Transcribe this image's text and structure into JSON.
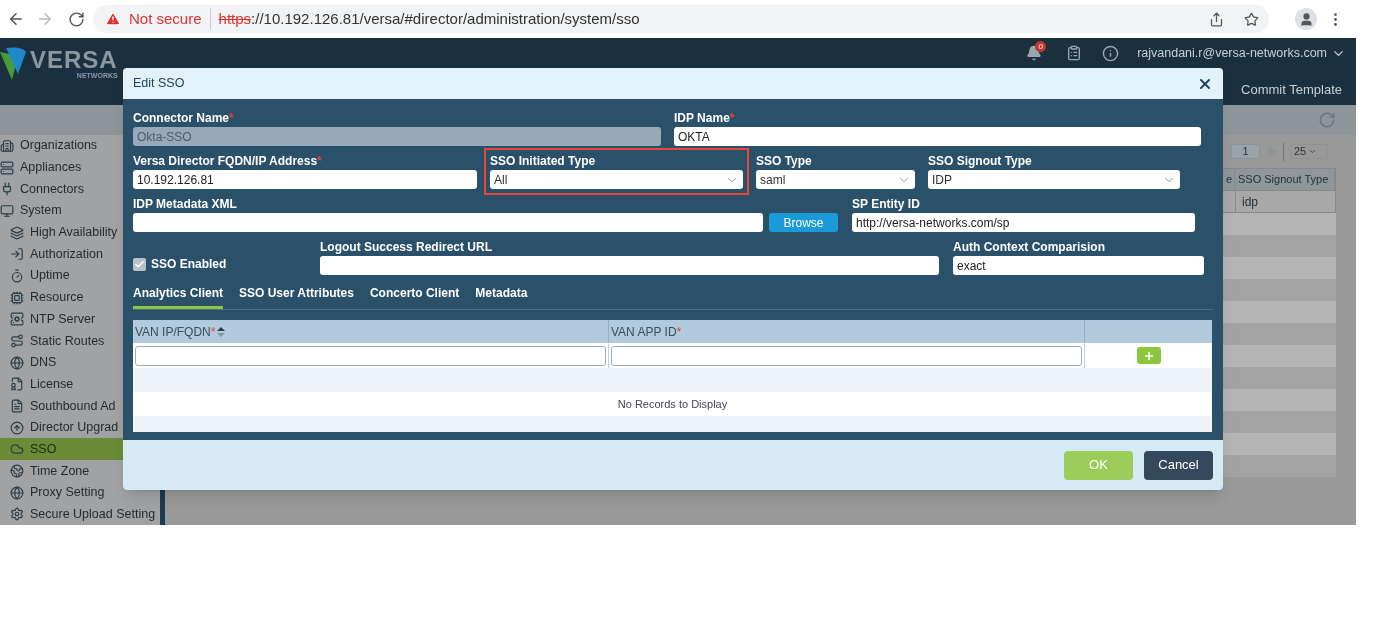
{
  "browser": {
    "security_warning": "Not secure",
    "url_scheme": "https",
    "url_rest": "://10.192.126.81/versa/#director/administration/system/sso"
  },
  "app_header": {
    "logo_text": "VERSA",
    "logo_subtext": "NETWORKS",
    "notification_count": "0",
    "user": "rajvandani.r@versa-networks.com",
    "action": "Commit Template"
  },
  "sidebar": {
    "items": [
      {
        "label": "Organizations",
        "selected": false
      },
      {
        "label": "Appliances",
        "selected": false
      },
      {
        "label": "Connectors",
        "selected": false
      },
      {
        "label": "System",
        "selected": false,
        "children": [
          {
            "label": "High Availability",
            "selected": false
          },
          {
            "label": "Authorization",
            "selected": false
          },
          {
            "label": "Uptime",
            "selected": false
          },
          {
            "label": "Resource",
            "selected": false
          },
          {
            "label": "NTP Server",
            "selected": false
          },
          {
            "label": "Static Routes",
            "selected": false
          },
          {
            "label": "DNS",
            "selected": false
          },
          {
            "label": "License",
            "selected": false
          },
          {
            "label": "Southbound Ad",
            "selected": false
          },
          {
            "label": "Director Upgrad",
            "selected": false
          },
          {
            "label": "SSO",
            "selected": true
          },
          {
            "label": "Time Zone",
            "selected": false
          },
          {
            "label": "Proxy Setting",
            "selected": false
          },
          {
            "label": "Secure Upload Setting",
            "selected": false
          }
        ]
      }
    ]
  },
  "background_table": {
    "page": "1",
    "page_size": "25",
    "columns": [
      "e",
      "SSO Signout Type"
    ],
    "rows": [
      [
        "",
        "idp"
      ]
    ]
  },
  "dialog": {
    "title": "Edit SSO",
    "fields": [
      {
        "kind": "text",
        "label": "Connector Name",
        "required_mark": "*",
        "value": "Okta-SSO",
        "disabled": true
      },
      {
        "kind": "text",
        "label": "IDP Name",
        "required_mark": "*",
        "value": "OKTA",
        "disabled": false
      },
      {
        "kind": "text",
        "label": "Versa Director FQDN/IP Address",
        "required_mark": "*",
        "value": "10.192.126.81",
        "disabled": false
      },
      {
        "kind": "select",
        "label": "SSO Initiated Type",
        "value": "All",
        "highlighted": true
      },
      {
        "kind": "select",
        "label": "SSO Type",
        "value": "saml",
        "highlighted": false
      },
      {
        "kind": "select",
        "label": "SSO Signout Type",
        "value": "IDP",
        "highlighted": false
      },
      {
        "kind": "file",
        "label": "IDP Metadata XML",
        "button": "Browse"
      },
      {
        "kind": "text",
        "label": "SP Entity ID",
        "value": "http://versa-networks.com/sp",
        "disabled": false
      },
      {
        "kind": "checkbox",
        "label": "SSO Enabled",
        "checked": true
      },
      {
        "kind": "text",
        "label": "Logout Success Redirect URL",
        "disabled": false
      },
      {
        "kind": "text",
        "label": "Auth Context Comparision",
        "value": "exact",
        "disabled": false
      }
    ],
    "tabs": [
      {
        "label": "Analytics Client",
        "selected": true
      },
      {
        "label": "SSO User Attributes",
        "selected": false
      },
      {
        "label": "Concerto Client",
        "selected": false
      },
      {
        "label": "Metadata",
        "selected": false
      }
    ],
    "table": {
      "columns": [
        {
          "label": "VAN IP/FQDN",
          "required_mark": "*",
          "sortable": true
        },
        {
          "label": "VAN APP ID",
          "required_mark": "*",
          "sortable": false
        }
      ],
      "empty_message": "No Records to Display"
    },
    "buttons": [
      {
        "kind": "primary",
        "label": "OK"
      },
      {
        "kind": "secondary",
        "label": "Cancel"
      }
    ]
  }
}
